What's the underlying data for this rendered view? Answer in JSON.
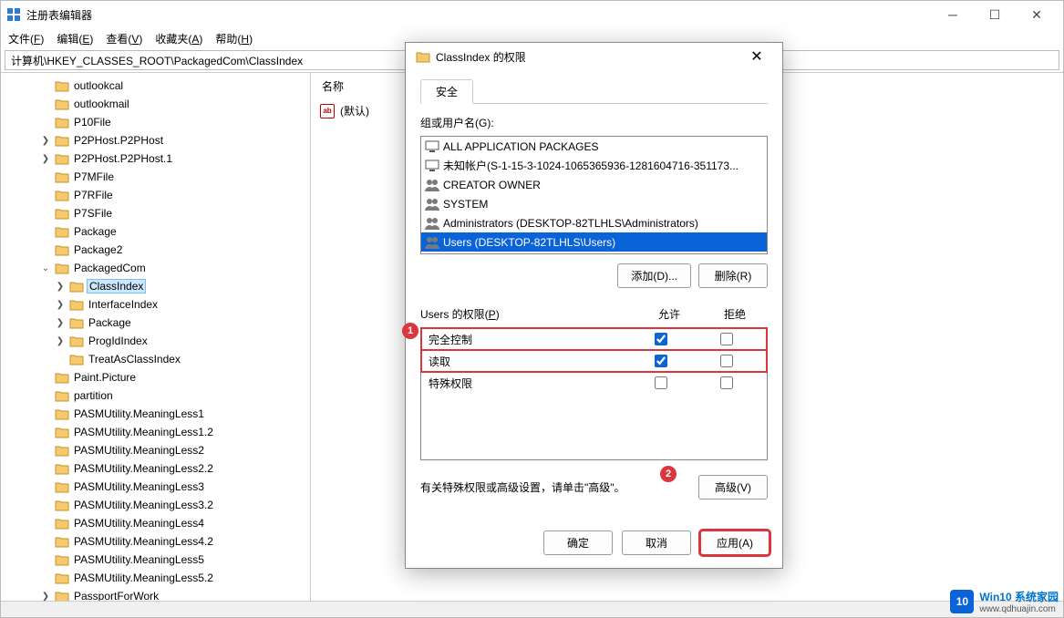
{
  "window": {
    "title": "注册表编辑器"
  },
  "menu": {
    "items": [
      {
        "t": "文件(",
        "u": "F",
        "s": ")"
      },
      {
        "t": "编辑(",
        "u": "E",
        "s": ")"
      },
      {
        "t": "查看(",
        "u": "V",
        "s": ")"
      },
      {
        "t": "收藏夹(",
        "u": "A",
        "s": ")"
      },
      {
        "t": "帮助(",
        "u": "H",
        "s": ")"
      }
    ]
  },
  "address": "计算机\\HKEY_CLASSES_ROOT\\PackagedCom\\ClassIndex",
  "tree": {
    "items": [
      {
        "depth": 2,
        "chev": "",
        "label": "outlookcal"
      },
      {
        "depth": 2,
        "chev": "",
        "label": "outlookmail"
      },
      {
        "depth": 2,
        "chev": "",
        "label": "P10File"
      },
      {
        "depth": 2,
        "chev": ">",
        "label": "P2PHost.P2PHost"
      },
      {
        "depth": 2,
        "chev": ">",
        "label": "P2PHost.P2PHost.1"
      },
      {
        "depth": 2,
        "chev": "",
        "label": "P7MFile"
      },
      {
        "depth": 2,
        "chev": "",
        "label": "P7RFile"
      },
      {
        "depth": 2,
        "chev": "",
        "label": "P7SFile"
      },
      {
        "depth": 2,
        "chev": "",
        "label": "Package"
      },
      {
        "depth": 2,
        "chev": "",
        "label": "Package2"
      },
      {
        "depth": 2,
        "chev": "v",
        "label": "PackagedCom"
      },
      {
        "depth": 3,
        "chev": ">",
        "label": "ClassIndex",
        "selected": true
      },
      {
        "depth": 3,
        "chev": ">",
        "label": "InterfaceIndex"
      },
      {
        "depth": 3,
        "chev": ">",
        "label": "Package"
      },
      {
        "depth": 3,
        "chev": ">",
        "label": "ProgIdIndex"
      },
      {
        "depth": 3,
        "chev": "",
        "label": "TreatAsClassIndex"
      },
      {
        "depth": 2,
        "chev": "",
        "label": "Paint.Picture"
      },
      {
        "depth": 2,
        "chev": "",
        "label": "partition"
      },
      {
        "depth": 2,
        "chev": "",
        "label": "PASMUtility.MeaningLess1"
      },
      {
        "depth": 2,
        "chev": "",
        "label": "PASMUtility.MeaningLess1.2"
      },
      {
        "depth": 2,
        "chev": "",
        "label": "PASMUtility.MeaningLess2"
      },
      {
        "depth": 2,
        "chev": "",
        "label": "PASMUtility.MeaningLess2.2"
      },
      {
        "depth": 2,
        "chev": "",
        "label": "PASMUtility.MeaningLess3"
      },
      {
        "depth": 2,
        "chev": "",
        "label": "PASMUtility.MeaningLess3.2"
      },
      {
        "depth": 2,
        "chev": "",
        "label": "PASMUtility.MeaningLess4"
      },
      {
        "depth": 2,
        "chev": "",
        "label": "PASMUtility.MeaningLess4.2"
      },
      {
        "depth": 2,
        "chev": "",
        "label": "PASMUtility.MeaningLess5"
      },
      {
        "depth": 2,
        "chev": "",
        "label": "PASMUtility.MeaningLess5.2"
      },
      {
        "depth": 2,
        "chev": ">",
        "label": "PassportForWork"
      }
    ]
  },
  "values": {
    "col_name": "名称",
    "default_name": "(默认)"
  },
  "dialog": {
    "title": "ClassIndex 的权限",
    "tab_security": "安全",
    "group_label": "组或用户名(G):",
    "group_underline": "G",
    "users": [
      "ALL APPLICATION PACKAGES",
      "未知帐户(S-1-15-3-1024-1065365936-1281604716-351173...",
      "CREATOR OWNER",
      "SYSTEM",
      "Administrators (DESKTOP-82TLHLS\\Administrators)",
      "Users (DESKTOP-82TLHLS\\Users)"
    ],
    "selected_user_index": 5,
    "add_btn": "添加(D)...",
    "remove_btn": "删除(R)",
    "perm_label_prefix": "Users 的权限(",
    "perm_label_u": "P",
    "perm_label_suffix": ")",
    "perm_allow": "允许",
    "perm_deny": "拒绝",
    "perms": [
      {
        "name": "完全控制",
        "allow": true,
        "deny": false,
        "hl": true
      },
      {
        "name": "读取",
        "allow": true,
        "deny": false,
        "hl": true
      },
      {
        "name": "特殊权限",
        "allow": false,
        "deny": false,
        "hl": false
      }
    ],
    "adv_text": "有关特殊权限或高级设置，请单击\"高级\"。",
    "adv_btn": "高级(V)",
    "ok": "确定",
    "cancel": "取消",
    "apply": "应用(A)",
    "badge1": "1",
    "badge2": "2"
  },
  "watermark": {
    "line1": "Win10 系统家园",
    "line2": "www.qdhuajin.com"
  }
}
